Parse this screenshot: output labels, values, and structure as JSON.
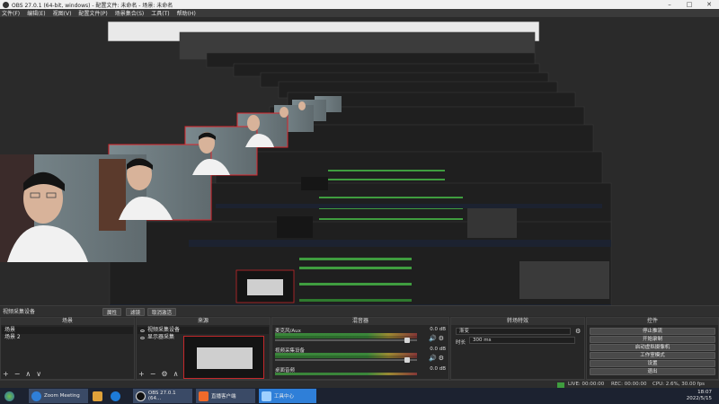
{
  "window": {
    "title": "OBS 27.0.1 (64-bit, windows) - 配置文件: 未命名 - 场景: 未命名"
  },
  "menu": [
    "文件(F)",
    "编辑(E)",
    "视图(V)",
    "配置文件(P)",
    "场景集合(S)",
    "工具(T)",
    "帮助(H)"
  ],
  "source_toolbar": {
    "label": "视频采集设备",
    "properties": "属性",
    "filters": "滤镜",
    "deactivate": "取消激活"
  },
  "scenes": {
    "title": "场景",
    "items": [
      "场景",
      "场景 2"
    ]
  },
  "sources": {
    "title": "来源",
    "items": [
      "视频采集设备",
      "显示器采集"
    ]
  },
  "mixer": {
    "title": "混音器",
    "channels": [
      {
        "name": "桌面音频",
        "db": "0.0 dB",
        "fader_level": 0.93
      },
      {
        "name": "视频采集设备",
        "db": "0.0 dB",
        "fader_level": 0.93
      },
      {
        "name": "麦克风/Aux",
        "db": "0.0 dB",
        "fader_level": 0.93
      }
    ]
  },
  "transitions": {
    "title": "转场特效",
    "type": "渐变",
    "duration_label": "时长",
    "duration": "300 ms"
  },
  "controls": {
    "title": "控件",
    "buttons": [
      "停止推流",
      "开始录制",
      "启动虚拟摄像机",
      "工作室模式",
      "设置",
      "退出"
    ]
  },
  "status": {
    "live": "LIVE: 00:00:00",
    "rec": "REC: 00:00:00",
    "cpu": "CPU: 2.6%, 30.00 fps"
  },
  "taskbar": {
    "items": [
      "Zoom Meeting",
      "OBS 27.0.1 (64...",
      "直播客户端",
      "工具中心"
    ],
    "time": "18:07",
    "date": "2022/5/15"
  },
  "colors": {
    "accent": "#2f7fd8",
    "selection_red": "#d9262c",
    "panel": "#272727"
  }
}
